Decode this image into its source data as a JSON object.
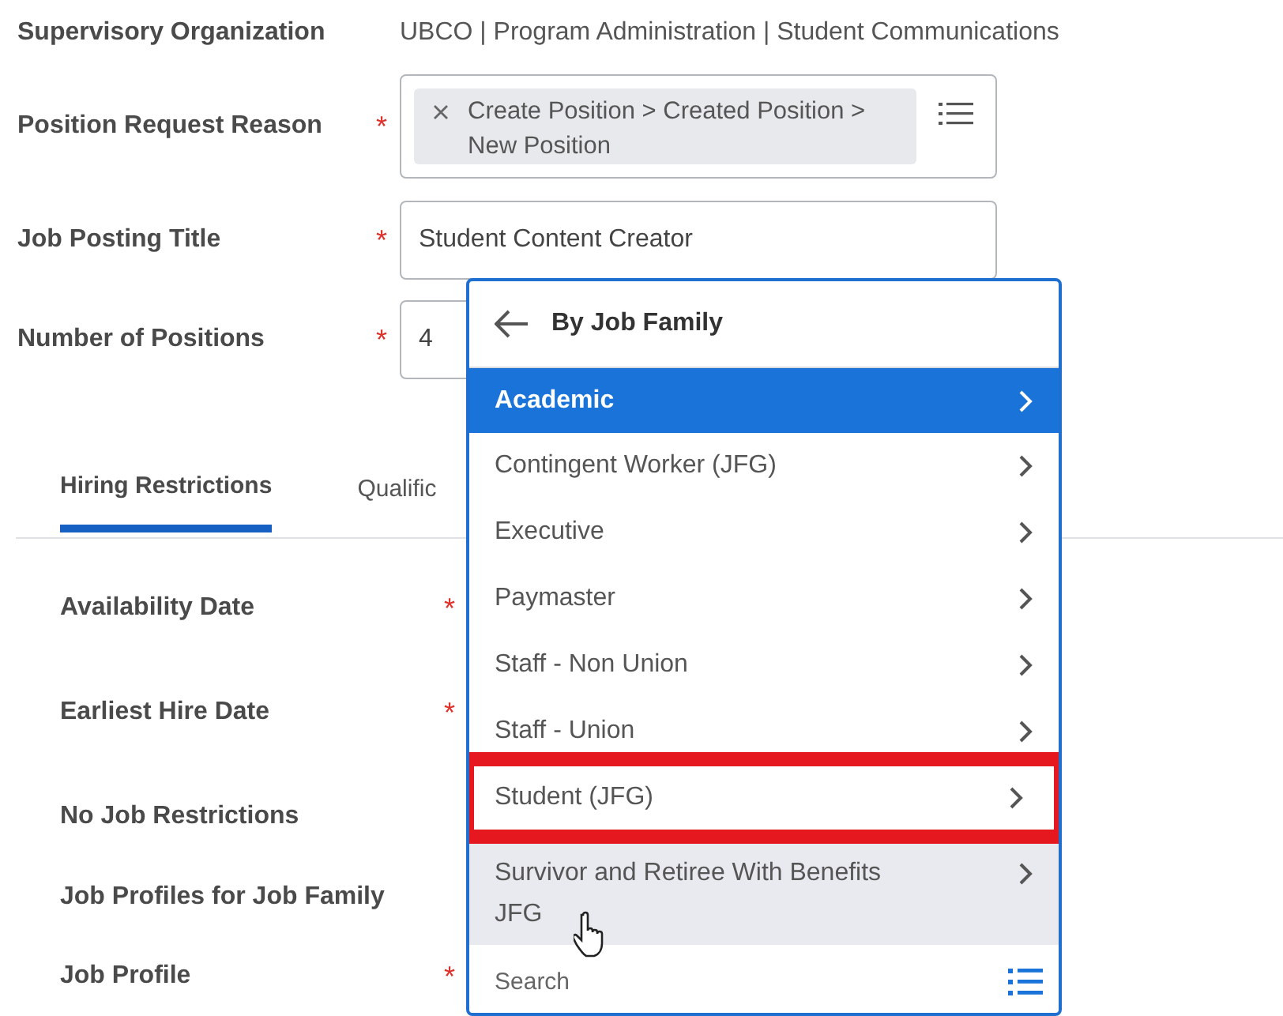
{
  "header_fields": [
    {
      "label": "Supervisory Organization",
      "kind": "text",
      "value": "UBCO | Program Administration | Student Communications"
    },
    {
      "label": "Position Request Reason",
      "asterisk": "*",
      "kind": "chips",
      "chip": "Create Position > Created Position > New Position"
    },
    {
      "label": "Job Posting Title",
      "asterisk": "*",
      "kind": "input",
      "value": "Student Content Creator"
    },
    {
      "label": "Number of Positions",
      "asterisk": "*",
      "kind": "input",
      "value": "4"
    }
  ],
  "tabs": [
    {
      "label": "Hiring Restrictions",
      "selected": true
    },
    {
      "label": "Qualific",
      "selected": false
    }
  ],
  "restriction_fields": [
    {
      "label": "Availability Date",
      "asterisk": "*"
    },
    {
      "label": "Earliest Hire Date",
      "asterisk": "*"
    },
    {
      "label": "No Job Restrictions"
    },
    {
      "label": "Job Profiles for Job Family"
    },
    {
      "label": "Job Profile",
      "asterisk": "*"
    }
  ],
  "dropdown": {
    "title": "By Job Family",
    "search_placeholder": "Search",
    "items": [
      {
        "label": "Academic",
        "selected": true,
        "hovered": false,
        "annotated": false
      },
      {
        "label": "Contingent Worker (JFG)",
        "selected": false,
        "hovered": false,
        "annotated": false
      },
      {
        "label": "Executive",
        "selected": false,
        "hovered": false,
        "annotated": false
      },
      {
        "label": "Paymaster",
        "selected": false,
        "hovered": false,
        "annotated": false
      },
      {
        "label": "Staff - Non Union",
        "selected": false,
        "hovered": false,
        "annotated": false
      },
      {
        "label": "Staff - Union",
        "selected": false,
        "hovered": false,
        "annotated": false
      },
      {
        "label": "Student (JFG)",
        "selected": false,
        "hovered": false,
        "annotated": true
      },
      {
        "label": "Survivor and Retiree With Benefits JFG",
        "selected": false,
        "hovered": true,
        "annotated": false
      }
    ]
  }
}
